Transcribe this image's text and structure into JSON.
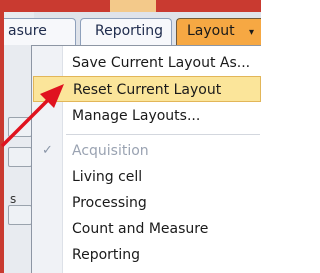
{
  "tabs": {
    "measure_label": "asure",
    "reporting_label": "Reporting",
    "layout_label": "Layout",
    "layout_caret": "▾"
  },
  "menu": {
    "items": [
      {
        "label": "Save Current Layout As..."
      },
      {
        "label": "Reset Current Layout",
        "highlighted": true
      },
      {
        "label": "Manage Layouts..."
      },
      {
        "label": "Acquisition",
        "checked": true,
        "disabled": true
      },
      {
        "label": "Living cell"
      },
      {
        "label": "Processing"
      },
      {
        "label": "Count and Measure"
      },
      {
        "label": "Reporting"
      }
    ],
    "check_glyph": "✓"
  },
  "side": {
    "letter": "s"
  },
  "colors": {
    "frame": "#c93a30",
    "highlight": "#fbe59a",
    "layout_tab": "#f6a843",
    "arrow": "#e0131f"
  }
}
